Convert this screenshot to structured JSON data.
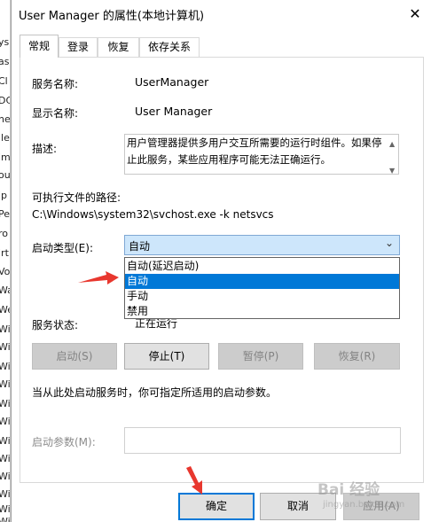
{
  "background_window": {
    "fragments": [
      "ys",
      "as",
      "Cl",
      "DC",
      "he",
      "ile",
      "im",
      "ou",
      "ip",
      "Pe",
      "ro",
      "irt",
      "Vol",
      "Wa",
      "We",
      "Wi",
      "Wi",
      "Wi",
      "Wi",
      "Wi",
      "Wi",
      "Wi",
      "Wi",
      "Wi",
      "Wi",
      "Wi",
      "Wi"
    ]
  },
  "dialog": {
    "title": "User Manager 的属性(本地计算机)",
    "close_glyph": "✕"
  },
  "tabs": [
    {
      "label": "常规",
      "active": true
    },
    {
      "label": "登录",
      "active": false
    },
    {
      "label": "恢复",
      "active": false
    },
    {
      "label": "依存关系",
      "active": false
    }
  ],
  "general": {
    "service_name_label": "服务名称:",
    "service_name_value": "UserManager",
    "display_name_label": "显示名称:",
    "display_name_value": "User Manager",
    "description_label": "描述:",
    "description_value": "用户管理器提供多用户交互所需要的运行时组件。如果停止此服务，某些应用程序可能无法正确运行。",
    "exe_path_label": "可执行文件的路径:",
    "exe_path_value": "C:\\Windows\\system32\\svchost.exe -k netsvcs",
    "startup_type_label": "启动类型(E):",
    "startup_type_value": "自动",
    "startup_options": [
      {
        "label": "自动(延迟启动)",
        "selected": false
      },
      {
        "label": "自动",
        "selected": true
      },
      {
        "label": "手动",
        "selected": false
      },
      {
        "label": "禁用",
        "selected": false
      }
    ],
    "service_status_label": "服务状态:",
    "service_status_value": "正在运行",
    "start_button": "启动(S)",
    "stop_button": "停止(T)",
    "pause_button": "暂停(P)",
    "resume_button": "恢复(R)",
    "start_params_hint": "当从此处启动服务时，你可指定所适用的启动参数。",
    "start_params_label": "启动参数(M):",
    "start_params_value": ""
  },
  "footer": {
    "ok_button": "确定",
    "cancel_button": "取消",
    "apply_button": "应用(A)"
  },
  "watermark": {
    "brand": "Bai 经验",
    "sub": "jingyan.baidu.com"
  },
  "colors": {
    "accent": "#0078d7",
    "annotation_arrow": "#e8372e"
  }
}
